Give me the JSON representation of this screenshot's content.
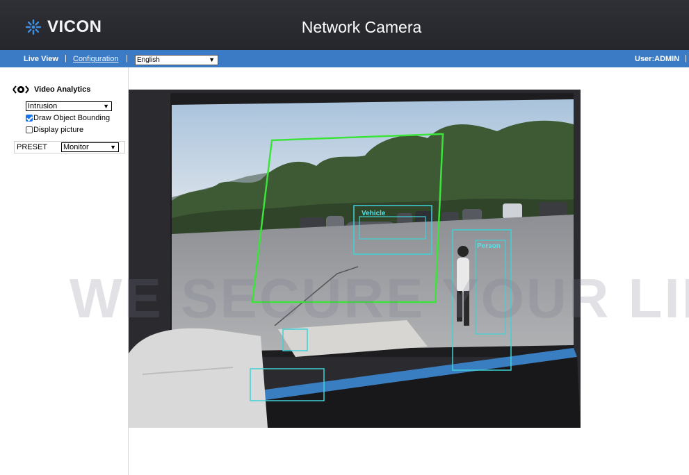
{
  "header": {
    "brand": "VICON",
    "title": "Network Camera"
  },
  "nav": {
    "live_view": "Live View",
    "separator": "|",
    "configuration": "Configuration",
    "language_selected": "English",
    "user": "User:ADMIN"
  },
  "sidebar": {
    "video_analytics_title": "Video Analytics",
    "analytics_mode": "Intrusion",
    "draw_object_bounding": {
      "label": "Draw Object Bounding",
      "checked": true
    },
    "display_picture": {
      "label": "Display picture",
      "checked": false
    },
    "preset_label": "PRESET",
    "preset_value": "Monitor"
  },
  "video": {
    "detections": [
      {
        "label": "Vehicle"
      },
      {
        "label": "Person"
      }
    ]
  },
  "watermark": "WE SECURE YOUR LIFE",
  "colors": {
    "header_bg": "#2c2d33",
    "nav_bg": "#3b7bc6",
    "zone_outline": "#3be33b",
    "bounding_box": "#3fd2d6"
  }
}
